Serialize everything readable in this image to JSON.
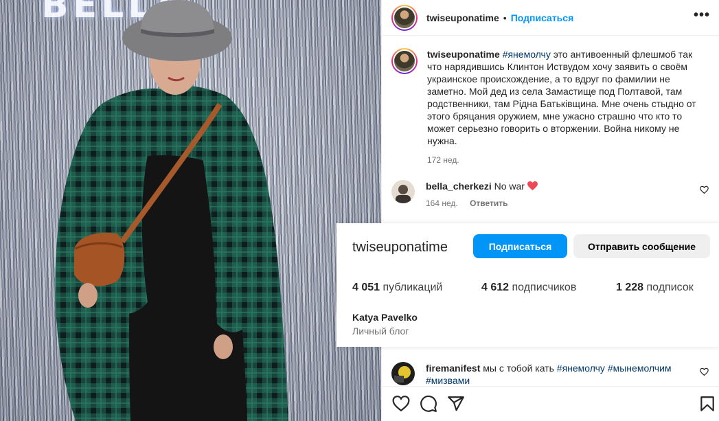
{
  "photo": {
    "sign_text": "BELLA",
    "alt": "photo"
  },
  "post_header": {
    "username": "twiseuponatime",
    "separator": "•",
    "follow_label": "Подписаться",
    "more_label": "•••"
  },
  "caption": {
    "username": "twiseuponatime",
    "hashtag": "#янемолчу",
    "text": " это антивоенный флешмоб так что нарядившись Клинтон Иствудом хочу заявить о своём украинское происхождение, а то вдруг по фамилии не заметно. Мой дед из села Замастище под Полтавой, там родственники, там Рідна Батьківщина. Мне очень стыдно от этого бряцания оружием, мне ужасно страшно что кто то может серьезно говорить о вторжении. Война никому не нужна.",
    "time": "172 нед."
  },
  "comments": [
    {
      "username": "bella_cherkezi",
      "text": "No war",
      "time": "164 нед.",
      "reply_label": "Ответить"
    },
    {
      "username": "firemanifest",
      "text": "мы с тобой кать",
      "tags": [
        "#янемолчу",
        "#мынемолчим",
        "#мизвами"
      ]
    }
  ],
  "profile_card": {
    "username": "twiseuponatime",
    "follow_label": "Подписаться",
    "message_label": "Отправить сообщение",
    "stats": [
      {
        "value": "4 051",
        "label": "публикаций"
      },
      {
        "value": "4 612",
        "label": "подписчиков"
      },
      {
        "value": "1 228",
        "label": "подписок"
      }
    ],
    "full_name": "Katya Pavelko",
    "category": "Личный блог"
  },
  "colors": {
    "accent": "#0095f6",
    "hashtag": "#00376b",
    "heart": "#ed4956"
  },
  "icons": [
    "heart-icon",
    "comment-icon",
    "share-icon",
    "bookmark-icon",
    "more-icon"
  ]
}
